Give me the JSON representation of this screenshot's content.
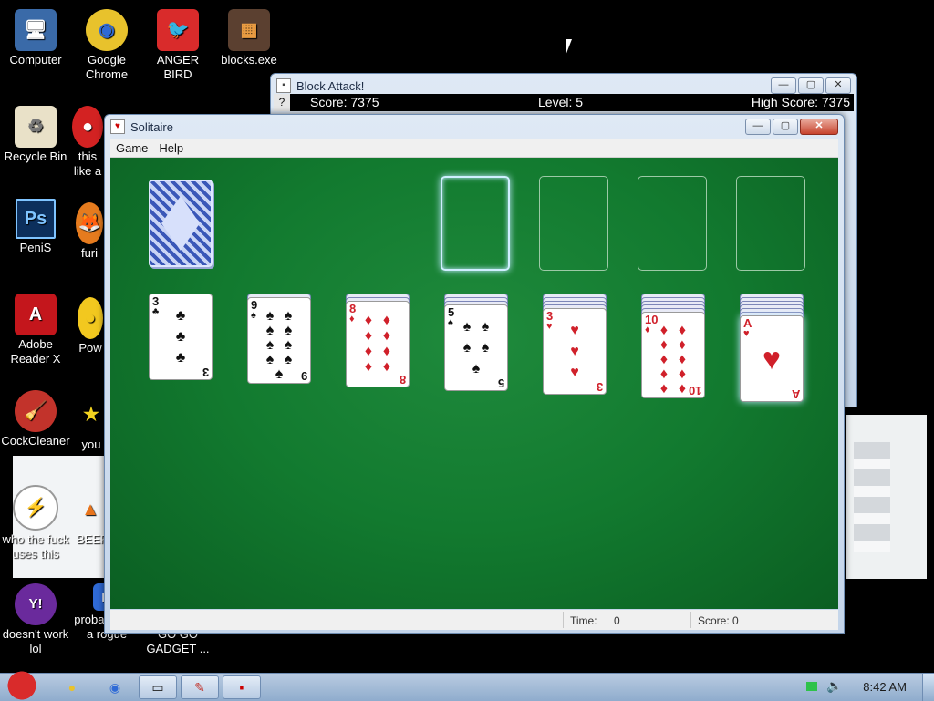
{
  "desktop": {
    "icons": [
      {
        "label": "Computer",
        "glyph": "🖥"
      },
      {
        "label": "Google Chrome",
        "glyph": "◉"
      },
      {
        "label": "ANGER BIRD",
        "glyph": "🐦"
      },
      {
        "label": "blocks.exe",
        "glyph": "▦"
      },
      {
        "label": "Recycle Bin",
        "glyph": "♻"
      },
      {
        "label": "this like a",
        "glyph": "●"
      },
      {
        "label": "PeniS",
        "glyph": "Ps"
      },
      {
        "label": "furi",
        "glyph": "🦊"
      },
      {
        "label": "Adobe Reader X",
        "glyph": "A"
      },
      {
        "label": "Pow",
        "glyph": "●"
      },
      {
        "label": "CockCleaner",
        "glyph": "🧹"
      },
      {
        "label": "you",
        "glyph": "★"
      },
      {
        "label": "who the fuck uses this",
        "glyph": "⚡"
      },
      {
        "label": "BEEF",
        "glyph": "▲"
      },
      {
        "label": "doesn't work lol",
        "glyph": "Y!"
      },
      {
        "label": "probably not a rogue",
        "glyph": "■"
      },
      {
        "label": "GO GO GADGET ...",
        "glyph": "⚙"
      }
    ]
  },
  "block_attack": {
    "title": "Block Attack!",
    "help": "?",
    "score": "Score: 7375",
    "level": "Level: 5",
    "high_score": "High Score: 7375"
  },
  "solitaire": {
    "title": "Solitaire",
    "menu": [
      "Game",
      "Help"
    ],
    "status": {
      "time_label": "Time:",
      "time_value": "0",
      "score_label": "Score: 0"
    },
    "tableau": [
      {
        "rank": "3",
        "suit": "♣",
        "color": "blk",
        "pips": 3
      },
      {
        "rank": "9",
        "suit": "♠",
        "color": "blk",
        "pips": 9
      },
      {
        "rank": "8",
        "suit": "♦",
        "color": "red",
        "pips": 8
      },
      {
        "rank": "5",
        "suit": "♠",
        "color": "blk",
        "pips": 5
      },
      {
        "rank": "3",
        "suit": "♥",
        "color": "red",
        "pips": 3
      },
      {
        "rank": "10",
        "suit": "♦",
        "color": "red",
        "pips": 10
      },
      {
        "rank": "A",
        "suit": "♥",
        "color": "red",
        "pips": 1
      }
    ]
  },
  "window_controls": {
    "minimize": "—",
    "maximize": "▢",
    "close": "✕"
  },
  "taskbar": {
    "clock": "8:42 AM"
  }
}
